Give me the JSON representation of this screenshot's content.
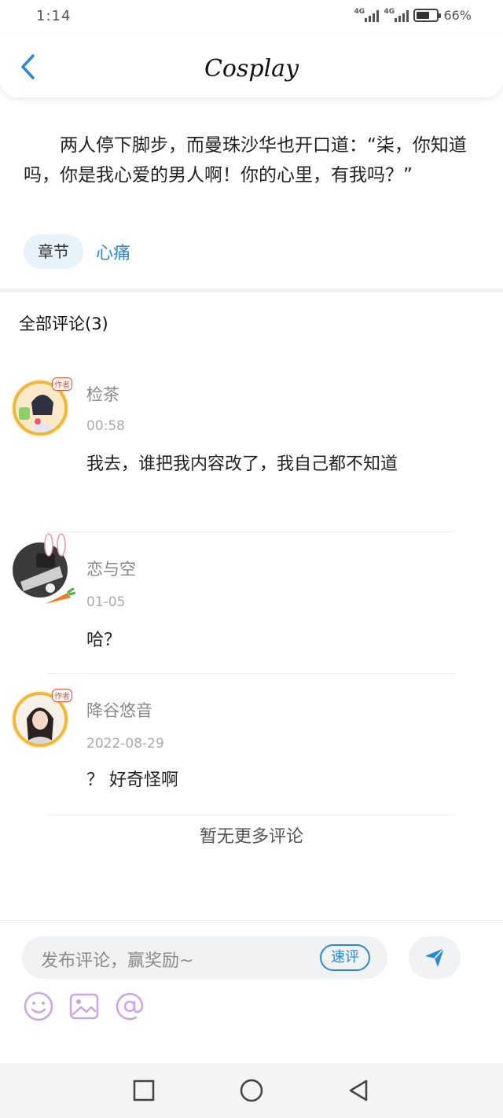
{
  "status": {
    "time": "1:14",
    "network1": "4G",
    "network2": "4G",
    "battery": "66%",
    "battery_level": 0.66
  },
  "header": {
    "title": "Cosplay",
    "back_icon": "chevron-left-icon"
  },
  "excerpt": {
    "text": "两人停下脚步，而曼珠沙华也开口道：“柒，你知道吗，你是我心爱的男人啊！你的心里，有我吗？”",
    "chapter_label": "章节",
    "chapter_name": "心痛"
  },
  "comments_section": {
    "title": "全部评论(3)",
    "items": [
      {
        "name": "检茶",
        "time": "00:58",
        "text": "我去，谁把我内容改了，我自己都不知道",
        "author_tag": "作者"
      },
      {
        "name": "恋与空",
        "time": "01-05",
        "text": "哈？"
      },
      {
        "name": "降谷悠音",
        "time": "2022-08-29",
        "text": "？ 好奇怪啊",
        "author_tag": "作者"
      }
    ],
    "no_more": "暂无更多评论"
  },
  "composer": {
    "placeholder": "发布评论，赢奖励~",
    "quick_label": "速评",
    "send_icon": "send-icon",
    "tools": [
      "emoji-icon",
      "image-icon",
      "mention-icon"
    ]
  },
  "colors": {
    "accent": "#2a8ad0",
    "chapter_bg": "#e6f3fb",
    "tool_purple": "#c9a6e8"
  }
}
